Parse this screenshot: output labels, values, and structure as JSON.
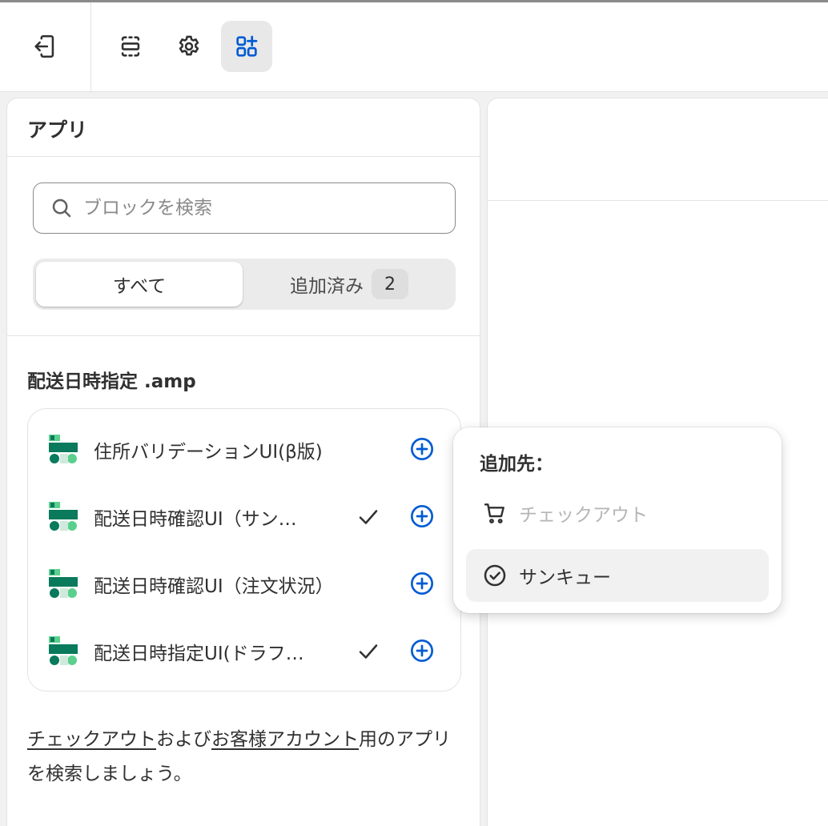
{
  "toolbar": {
    "exit_icon": "exit-icon",
    "layout_icon": "layout-icon",
    "settings_icon": "gear-icon",
    "apps_icon": "apps-add-icon"
  },
  "panel": {
    "title": "アプリ",
    "search": {
      "placeholder": "ブロックを検索",
      "value": ""
    },
    "tabs": [
      {
        "label": "すべて",
        "selected": true
      },
      {
        "label": "追加済み",
        "count": "2",
        "selected": false
      }
    ],
    "section_title": "配送日時指定 .amp",
    "items": [
      {
        "name": "住所バリデーションUI(β版)",
        "added": false
      },
      {
        "name": "配送日時確認UI（サン…",
        "added": true
      },
      {
        "name": "配送日時確認UI（注文状況）",
        "added": false
      },
      {
        "name": "配送日時指定UI(ドラフ…",
        "added": true
      }
    ],
    "footer": {
      "link1": "チェックアウト",
      "text1": "および",
      "link2": "お客様アカウント",
      "text2": "用のアプリを検索しましょう。"
    }
  },
  "popover": {
    "title": "追加先：",
    "options": [
      {
        "label": "チェックアウト",
        "icon": "cart-icon",
        "disabled": true
      },
      {
        "label": "サンキュー",
        "icon": "check-circle-icon",
        "disabled": false
      }
    ]
  },
  "colors": {
    "accent_blue": "#005bd3",
    "app_icon_green": "#0a7a5c",
    "app_icon_light": "#5bd08e"
  }
}
